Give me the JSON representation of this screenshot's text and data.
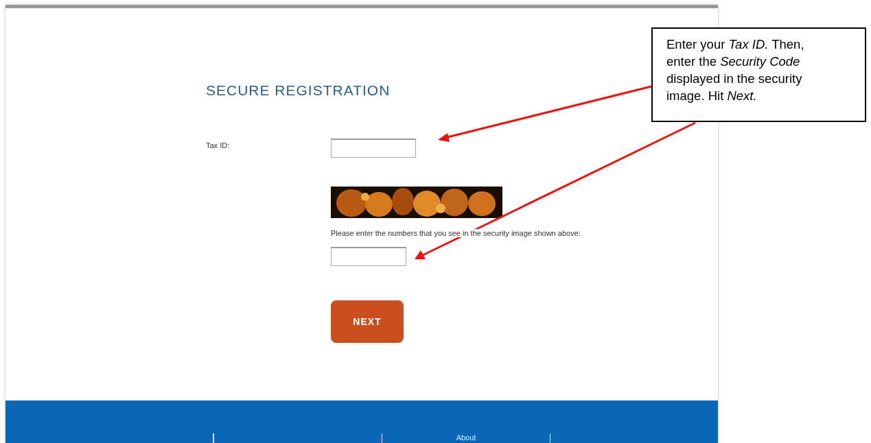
{
  "form": {
    "title": "SECURE REGISTRATION",
    "tax_id": {
      "label": "Tax ID:"
    },
    "security_prompt": "Please enter the numbers that you see in the security image shown above:",
    "next_button": "NEXT"
  },
  "footer": {
    "links": [
      "About"
    ]
  },
  "callout": {
    "text": "Enter your *Tax ID.* Then, enter the *Security Code* displayed in the security image. Hit *Next.*"
  }
}
